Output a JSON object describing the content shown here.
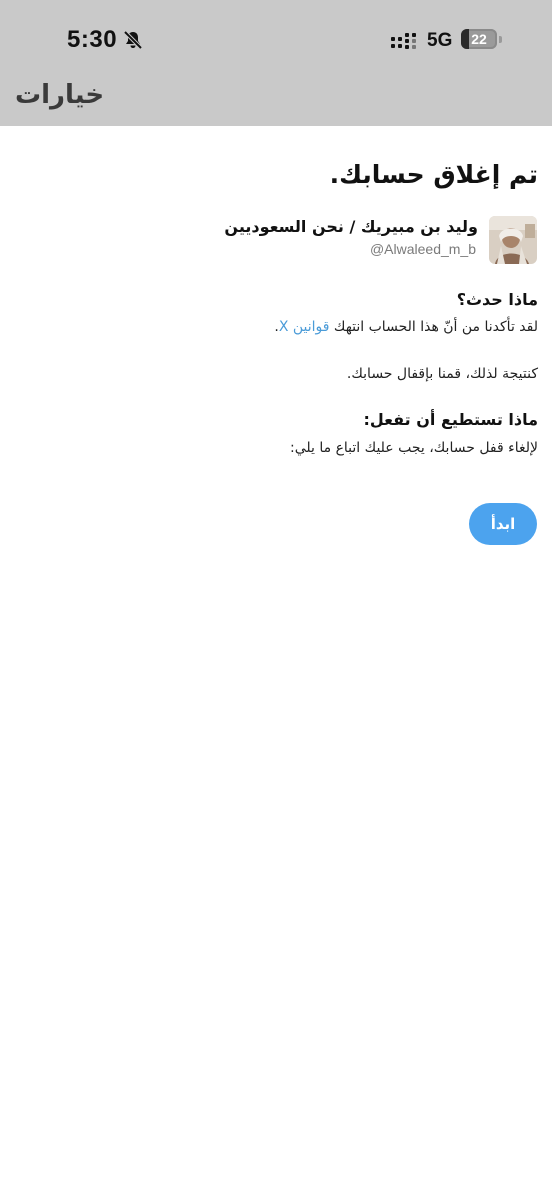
{
  "status_bar": {
    "time": "5:30",
    "network": "5G",
    "battery_level": "22",
    "battery_fraction": 0.22,
    "icons": [
      "bell-slash-icon",
      "signal-icon",
      "battery-icon"
    ]
  },
  "header": {
    "options_label": "خيارات",
    "background": "#c9c9c9"
  },
  "main": {
    "heading": "تم إغلاق حسابك.",
    "account": {
      "display_name": "وليد بن مبيريك / نحن السعوديين",
      "handle": "@Alwaleed_m_b"
    },
    "what_happened": {
      "title": "ماذا حدث؟",
      "text_before_link": "لقد تأكدنا من أنّ هذا الحساب انتهك ",
      "link_text": "قوانين X",
      "text_after_link": ".",
      "consequence": "كنتيجة لذلك، قمنا بإقفال حسابك."
    },
    "what_you_can_do": {
      "title": "ماذا تستطيع أن تفعل:",
      "text": "لإلغاء قفل حسابك، يجب عليك اتباع ما يلي:"
    },
    "start_button_label": "ابدأ"
  },
  "colors": {
    "accent": "#4ca3ee",
    "link": "#4a9bd8",
    "text": "#111111",
    "muted": "#7a7a7a"
  }
}
